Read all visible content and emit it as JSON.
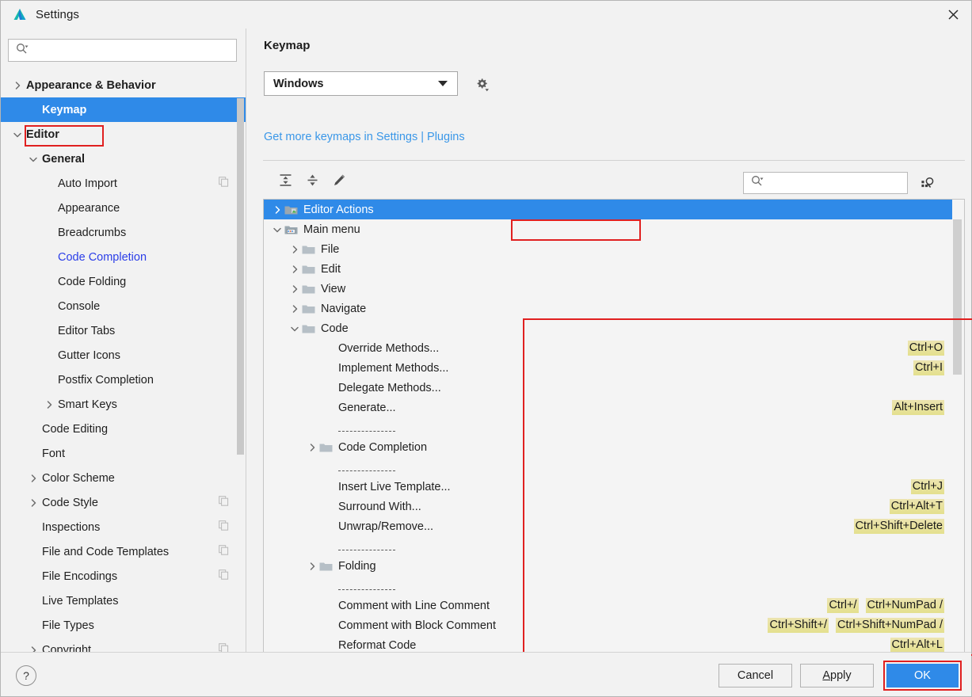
{
  "window": {
    "title": "Settings",
    "app_icon": "intellij-logo-icon",
    "close_icon": "close-icon"
  },
  "sidebar": {
    "search": {
      "placeholder": "",
      "value": "",
      "icon": "search-icon"
    },
    "items": [
      {
        "label": "Appearance & Behavior",
        "indent": 0,
        "twisty": "collapsed",
        "bold": true,
        "selected": false,
        "blue": false,
        "badge": false
      },
      {
        "label": "Keymap",
        "indent": 1,
        "twisty": "none",
        "bold": true,
        "selected": true,
        "blue": false,
        "badge": false
      },
      {
        "label": "Editor",
        "indent": 0,
        "twisty": "expanded",
        "bold": true,
        "selected": false,
        "blue": false,
        "badge": false
      },
      {
        "label": "General",
        "indent": 1,
        "twisty": "expanded",
        "bold": true,
        "selected": false,
        "blue": false,
        "badge": false
      },
      {
        "label": "Auto Import",
        "indent": 2,
        "twisty": "none",
        "bold": false,
        "selected": false,
        "blue": false,
        "badge": true
      },
      {
        "label": "Appearance",
        "indent": 2,
        "twisty": "none",
        "bold": false,
        "selected": false,
        "blue": false,
        "badge": false
      },
      {
        "label": "Breadcrumbs",
        "indent": 2,
        "twisty": "none",
        "bold": false,
        "selected": false,
        "blue": false,
        "badge": false
      },
      {
        "label": "Code Completion",
        "indent": 2,
        "twisty": "none",
        "bold": false,
        "selected": false,
        "blue": true,
        "badge": false
      },
      {
        "label": "Code Folding",
        "indent": 2,
        "twisty": "none",
        "bold": false,
        "selected": false,
        "blue": false,
        "badge": false
      },
      {
        "label": "Console",
        "indent": 2,
        "twisty": "none",
        "bold": false,
        "selected": false,
        "blue": false,
        "badge": false
      },
      {
        "label": "Editor Tabs",
        "indent": 2,
        "twisty": "none",
        "bold": false,
        "selected": false,
        "blue": false,
        "badge": false
      },
      {
        "label": "Gutter Icons",
        "indent": 2,
        "twisty": "none",
        "bold": false,
        "selected": false,
        "blue": false,
        "badge": false
      },
      {
        "label": "Postfix Completion",
        "indent": 2,
        "twisty": "none",
        "bold": false,
        "selected": false,
        "blue": false,
        "badge": false
      },
      {
        "label": "Smart Keys",
        "indent": 2,
        "twisty": "collapsed",
        "bold": false,
        "selected": false,
        "blue": false,
        "badge": false
      },
      {
        "label": "Code Editing",
        "indent": 1,
        "twisty": "none",
        "bold": false,
        "selected": false,
        "blue": false,
        "badge": false
      },
      {
        "label": "Font",
        "indent": 1,
        "twisty": "none",
        "bold": false,
        "selected": false,
        "blue": false,
        "badge": false
      },
      {
        "label": "Color Scheme",
        "indent": 1,
        "twisty": "collapsed",
        "bold": false,
        "selected": false,
        "blue": false,
        "badge": false
      },
      {
        "label": "Code Style",
        "indent": 1,
        "twisty": "collapsed",
        "bold": false,
        "selected": false,
        "blue": false,
        "badge": true
      },
      {
        "label": "Inspections",
        "indent": 1,
        "twisty": "none",
        "bold": false,
        "selected": false,
        "blue": false,
        "badge": true
      },
      {
        "label": "File and Code Templates",
        "indent": 1,
        "twisty": "none",
        "bold": false,
        "selected": false,
        "blue": false,
        "badge": true
      },
      {
        "label": "File Encodings",
        "indent": 1,
        "twisty": "none",
        "bold": false,
        "selected": false,
        "blue": false,
        "badge": true
      },
      {
        "label": "Live Templates",
        "indent": 1,
        "twisty": "none",
        "bold": false,
        "selected": false,
        "blue": false,
        "badge": false
      },
      {
        "label": "File Types",
        "indent": 1,
        "twisty": "none",
        "bold": false,
        "selected": false,
        "blue": false,
        "badge": false
      },
      {
        "label": "Copyright",
        "indent": 1,
        "twisty": "collapsed",
        "bold": false,
        "selected": false,
        "blue": false,
        "badge": true
      }
    ]
  },
  "main": {
    "title": "Keymap",
    "keymap_select": {
      "value": "Windows",
      "icon": "chevron-down-icon"
    },
    "gear_icon": "gear-icon",
    "plugins_link": "Get more keymaps in Settings | Plugins",
    "toolbar": {
      "expand_all_icon": "expand-all-icon",
      "collapse_all_icon": "collapse-all-icon",
      "edit_shortcut_icon": "pencil-icon",
      "search_placeholder": "",
      "search_value": "",
      "search_icon": "search-icon",
      "find_by_shortcut_icon": "find-by-shortcut-icon"
    },
    "tree": [
      {
        "label": "Editor Actions",
        "indent": 0,
        "twisty": "collapsed",
        "icon": "editor-actions-folder-icon",
        "selected": true,
        "sep": false,
        "keys": []
      },
      {
        "label": "Main menu",
        "indent": 0,
        "twisty": "expanded",
        "icon": "main-menu-folder-icon",
        "selected": false,
        "sep": false,
        "keys": []
      },
      {
        "label": "File",
        "indent": 1,
        "twisty": "collapsed",
        "icon": "folder-icon",
        "selected": false,
        "sep": false,
        "keys": []
      },
      {
        "label": "Edit",
        "indent": 1,
        "twisty": "collapsed",
        "icon": "folder-icon",
        "selected": false,
        "sep": false,
        "keys": []
      },
      {
        "label": "View",
        "indent": 1,
        "twisty": "collapsed",
        "icon": "folder-icon",
        "selected": false,
        "sep": false,
        "keys": []
      },
      {
        "label": "Navigate",
        "indent": 1,
        "twisty": "collapsed",
        "icon": "folder-icon",
        "selected": false,
        "sep": false,
        "keys": []
      },
      {
        "label": "Code",
        "indent": 1,
        "twisty": "expanded",
        "icon": "folder-icon",
        "selected": false,
        "sep": false,
        "keys": []
      },
      {
        "label": "Override Methods...",
        "indent": 2,
        "twisty": "none",
        "icon": "none",
        "selected": false,
        "sep": false,
        "keys": [
          "Ctrl+O"
        ]
      },
      {
        "label": "Implement Methods...",
        "indent": 2,
        "twisty": "none",
        "icon": "none",
        "selected": false,
        "sep": false,
        "keys": [
          "Ctrl+I"
        ]
      },
      {
        "label": "Delegate Methods...",
        "indent": 2,
        "twisty": "none",
        "icon": "none",
        "selected": false,
        "sep": false,
        "keys": []
      },
      {
        "label": "Generate...",
        "indent": 2,
        "twisty": "none",
        "icon": "none",
        "selected": false,
        "sep": false,
        "keys": [
          "Alt+Insert"
        ]
      },
      {
        "label": "",
        "indent": 2,
        "twisty": "none",
        "icon": "none",
        "selected": false,
        "sep": true,
        "keys": []
      },
      {
        "label": "Code Completion",
        "indent": 2,
        "twisty": "collapsed",
        "icon": "folder-icon",
        "selected": false,
        "sep": false,
        "keys": []
      },
      {
        "label": "",
        "indent": 2,
        "twisty": "none",
        "icon": "none",
        "selected": false,
        "sep": true,
        "keys": []
      },
      {
        "label": "Insert Live Template...",
        "indent": 2,
        "twisty": "none",
        "icon": "none",
        "selected": false,
        "sep": false,
        "keys": [
          "Ctrl+J"
        ]
      },
      {
        "label": "Surround With...",
        "indent": 2,
        "twisty": "none",
        "icon": "none",
        "selected": false,
        "sep": false,
        "keys": [
          "Ctrl+Alt+T"
        ]
      },
      {
        "label": "Unwrap/Remove...",
        "indent": 2,
        "twisty": "none",
        "icon": "none",
        "selected": false,
        "sep": false,
        "keys": [
          "Ctrl+Shift+Delete"
        ]
      },
      {
        "label": "",
        "indent": 2,
        "twisty": "none",
        "icon": "none",
        "selected": false,
        "sep": true,
        "keys": []
      },
      {
        "label": "Folding",
        "indent": 2,
        "twisty": "collapsed",
        "icon": "folder-icon",
        "selected": false,
        "sep": false,
        "keys": []
      },
      {
        "label": "",
        "indent": 2,
        "twisty": "none",
        "icon": "none",
        "selected": false,
        "sep": true,
        "keys": []
      },
      {
        "label": "Comment with Line Comment",
        "indent": 2,
        "twisty": "none",
        "icon": "none",
        "selected": false,
        "sep": false,
        "keys": [
          "Ctrl+/",
          "Ctrl+NumPad /"
        ]
      },
      {
        "label": "Comment with Block Comment",
        "indent": 2,
        "twisty": "none",
        "icon": "none",
        "selected": false,
        "sep": false,
        "keys": [
          "Ctrl+Shift+/",
          "Ctrl+Shift+NumPad /"
        ]
      },
      {
        "label": "Reformat Code",
        "indent": 2,
        "twisty": "none",
        "icon": "none",
        "selected": false,
        "sep": false,
        "keys": [
          "Ctrl+Alt+L"
        ]
      }
    ]
  },
  "footer": {
    "help_label": "?",
    "cancel_label": "Cancel",
    "apply_mnemonic": "A",
    "apply_rest": "pply",
    "ok_label": "OK"
  },
  "colors": {
    "accent_blue": "#2f8ae8",
    "link_blue": "#3a97e8",
    "annotation_red": "#e02020",
    "shortcut_yellow": "#e4e08e",
    "window_bg": "#f2f2f2"
  }
}
